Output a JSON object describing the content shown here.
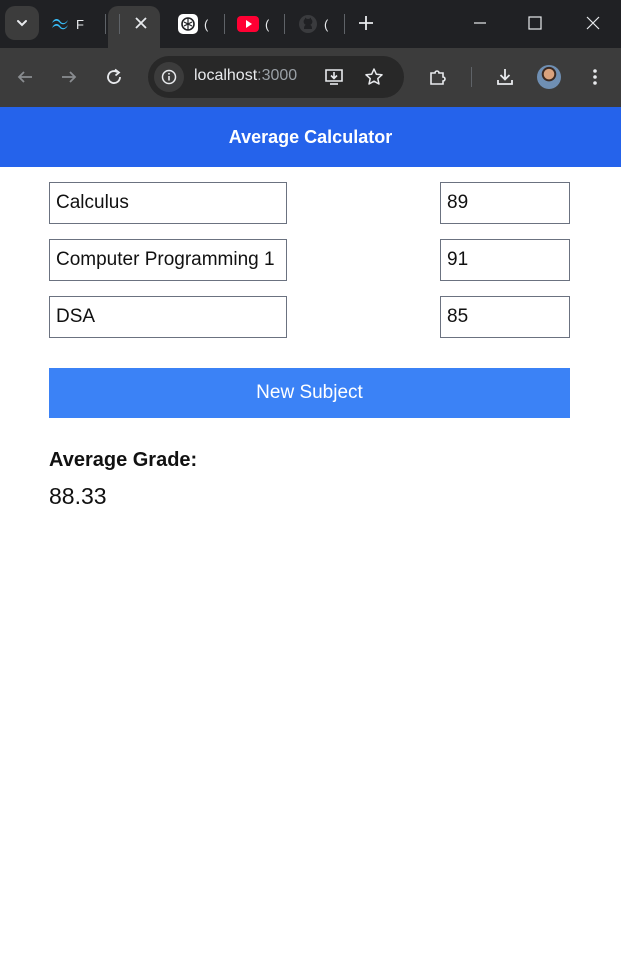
{
  "browser": {
    "tabs": [
      {
        "icon": "tailwind-icon",
        "title": "F"
      },
      {
        "icon": "openai-icon",
        "title": "("
      },
      {
        "icon": "youtube-icon",
        "title": "("
      },
      {
        "icon": "github-icon",
        "title": "("
      }
    ],
    "url_host": "localhost",
    "url_port": ":3000"
  },
  "app": {
    "title": "Average Calculator",
    "subjects": [
      {
        "name": "Calculus",
        "grade": "89"
      },
      {
        "name": "Computer Programming 1",
        "grade": "91"
      },
      {
        "name": "DSA",
        "grade": "85"
      }
    ],
    "new_subject_label": "New Subject",
    "average_label": "Average Grade:",
    "average_value": "88.33"
  },
  "colors": {
    "header": "#2563eb",
    "button": "#3b82f6",
    "chrome_dark": "#202124",
    "toolbar": "#3c3c3c"
  }
}
